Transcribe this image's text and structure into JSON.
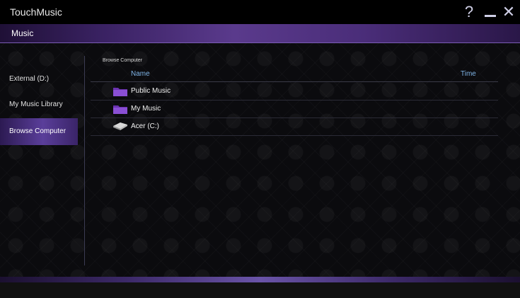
{
  "window": {
    "title": "TouchMusic",
    "help_glyph": "?",
    "close_glyph": "✕"
  },
  "section": {
    "title": "Music"
  },
  "sidebar": {
    "items": [
      {
        "label": "External (D:)",
        "active": false
      },
      {
        "label": "My Music Library",
        "active": false
      },
      {
        "label": "Browse Computer",
        "active": true
      }
    ]
  },
  "browser": {
    "breadcrumb": "Browse Computer",
    "columns": {
      "name": "Name",
      "time": "Time"
    },
    "rows": [
      {
        "name": "Public Music",
        "icon": "folder-icon"
      },
      {
        "name": "My Music",
        "icon": "folder-icon"
      },
      {
        "name": "Acer (C:)",
        "icon": "drive-icon"
      }
    ]
  },
  "colors": {
    "accent": "#5a3e9a",
    "column_header": "#7fb4e6",
    "folder": "#7a3fc0"
  }
}
